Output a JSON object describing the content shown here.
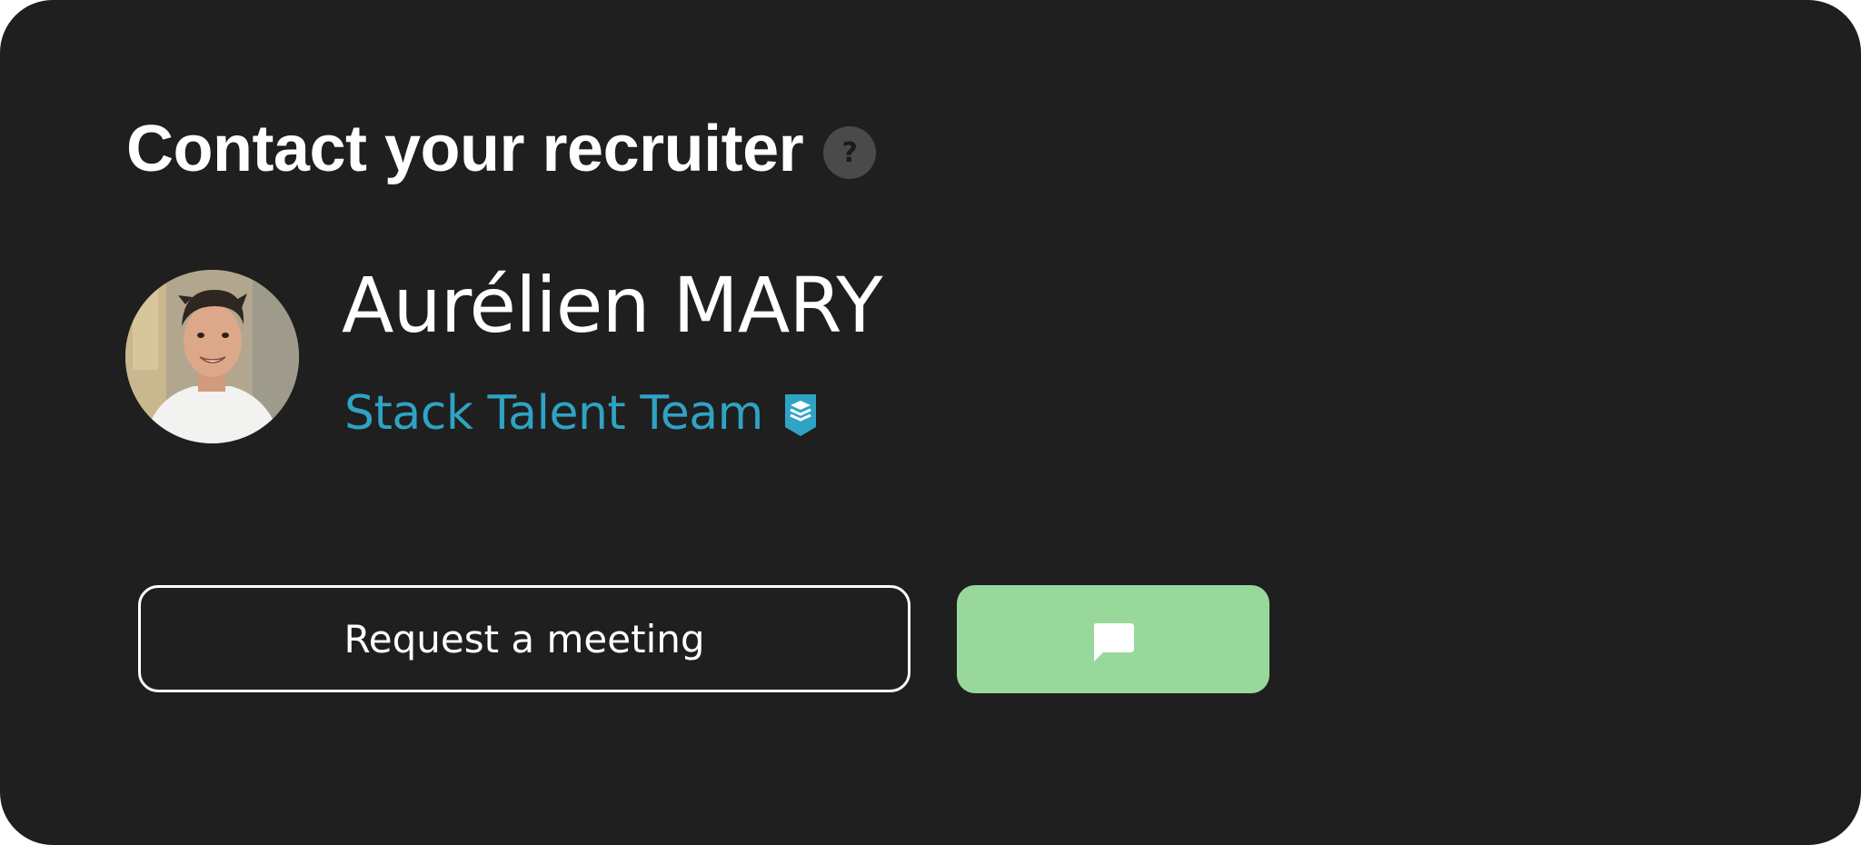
{
  "card": {
    "title": "Contact your recruiter",
    "help_icon": "question-mark-icon",
    "help_glyph": "?"
  },
  "recruiter": {
    "name": "Aurélien MARY",
    "team": "Stack Talent Team",
    "team_badge_icon": "stack-shield-icon",
    "avatar_icon": "recruiter-photo"
  },
  "actions": {
    "meeting_label": "Request a meeting",
    "chat_icon": "chat-bubble-icon"
  },
  "colors": {
    "card_background": "#1f1f1f",
    "accent_team": "#2fa3c4",
    "chat_button": "#98d99b"
  }
}
